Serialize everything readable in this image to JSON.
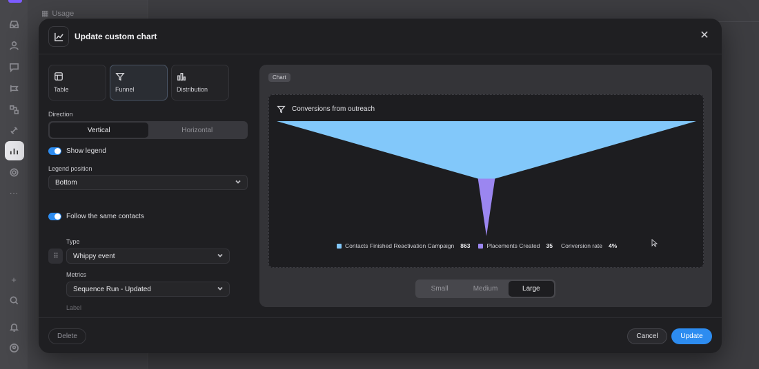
{
  "background": {
    "sidebar_section_label": "Usage"
  },
  "modal": {
    "title": "Update custom chart",
    "chart_types": [
      {
        "label": "Table",
        "icon": "table-icon",
        "selected": false
      },
      {
        "label": "Funnel",
        "icon": "funnel-icon",
        "selected": true
      },
      {
        "label": "Distribution",
        "icon": "bar-chart-icon",
        "selected": false
      }
    ],
    "direction": {
      "label": "Direction",
      "options": [
        "Vertical",
        "Horizontal"
      ],
      "selected": "Vertical"
    },
    "show_legend": {
      "label": "Show legend",
      "on": true
    },
    "legend_position": {
      "label": "Legend position",
      "value": "Bottom"
    },
    "follow_same_contacts": {
      "label": "Follow the same contacts",
      "on": true
    },
    "step": {
      "type_label": "Type",
      "type_value": "Whippy event",
      "metrics_label": "Metrics",
      "metrics_value": "Sequence Run - Updated",
      "label_label": "Label"
    },
    "preview": {
      "tag": "Chart",
      "chart_title": "Conversions from outreach",
      "sizes": [
        "Small",
        "Medium",
        "Large"
      ],
      "selected_size": "Large"
    },
    "footer": {
      "delete_label": "Delete",
      "cancel_label": "Cancel",
      "update_label": "Update"
    }
  },
  "colors": {
    "accent": "#2d8cf0",
    "stage1": "#82c8fa",
    "stage2": "#9b86f0"
  },
  "chart_data": {
    "type": "funnel",
    "title": "Conversions from outreach",
    "stages": [
      {
        "name": "Contacts Finished Reactivation Campaign",
        "value": 863
      },
      {
        "name": "Placements Created",
        "value": 35
      }
    ],
    "conversion_rate_label": "Conversion rate",
    "conversion_rate": "4%",
    "legend_placement": "bottom",
    "orientation": "vertical"
  }
}
